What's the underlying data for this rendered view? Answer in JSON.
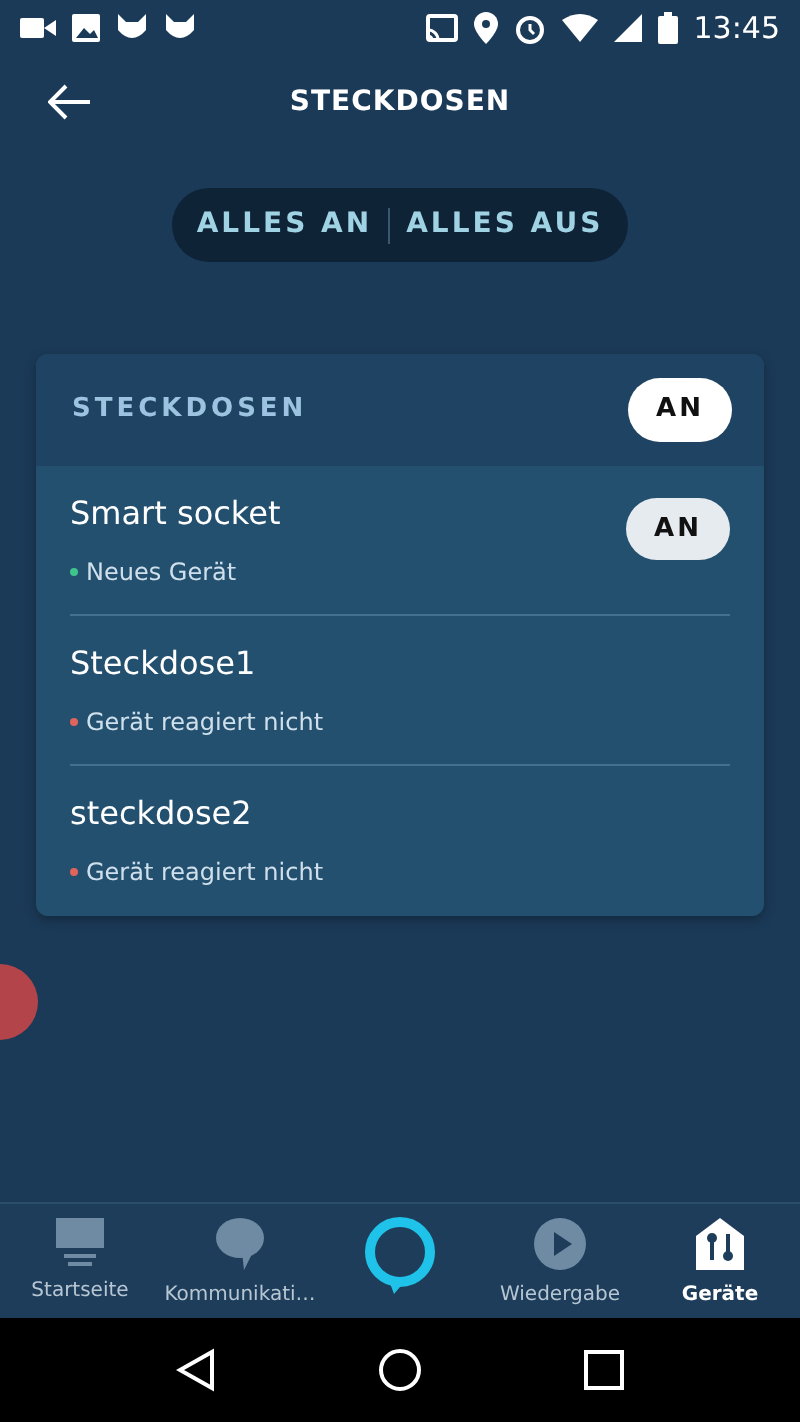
{
  "status_bar": {
    "time": "13:45"
  },
  "header": {
    "title": "STECKDOSEN"
  },
  "group_actions": [
    "ALLES AN",
    "ALLES AUS"
  ],
  "card": {
    "title": "STECKDOSEN",
    "toggle": "AN",
    "devices": [
      {
        "name": "Smart socket",
        "status": "Neues Gerät",
        "color": "#3fc48c",
        "toggle": "AN"
      },
      {
        "name": "Steckdose1",
        "status": "Gerät reagiert nicht",
        "color": "#e0645c"
      },
      {
        "name": "steckdose2",
        "status": "Gerät reagiert nicht",
        "color": "#e0645c"
      }
    ]
  },
  "bottom_nav": [
    {
      "kind": "home",
      "label": "Startseite",
      "selected": false
    },
    {
      "kind": "chat",
      "label": "Kommunikati…",
      "selected": false
    },
    {
      "kind": "alexa",
      "selected": false
    },
    {
      "kind": "play",
      "label": "Wiedergabe",
      "selected": false
    },
    {
      "kind": "devices",
      "label": "Geräte",
      "selected": true
    }
  ]
}
